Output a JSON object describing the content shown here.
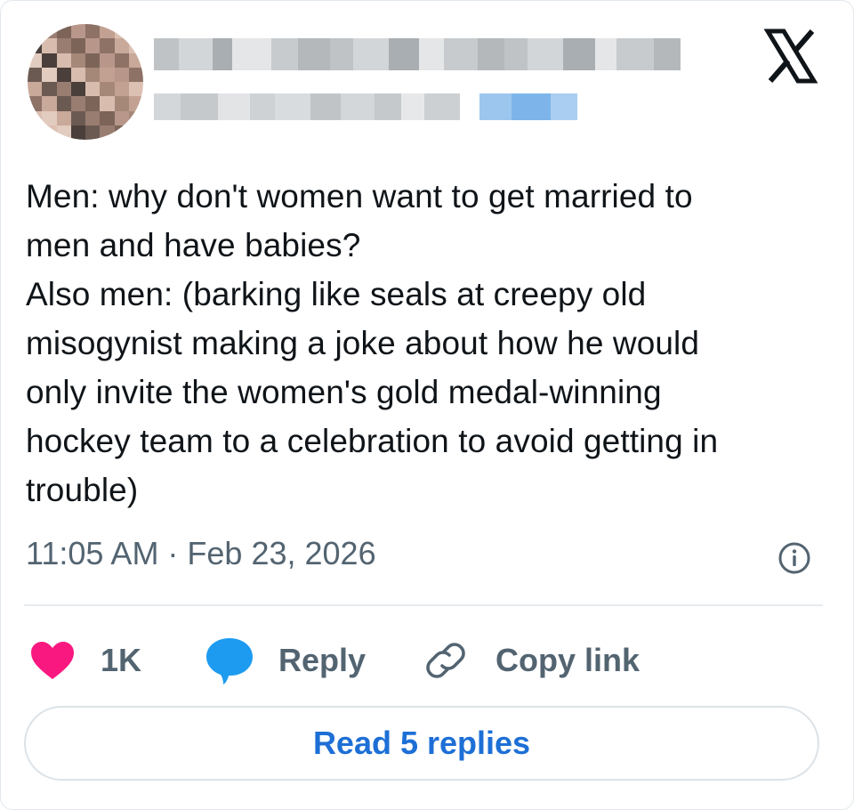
{
  "header": {
    "display_name": "",
    "handle": "",
    "logo": "x-logo-icon"
  },
  "tweet": {
    "lines": [
      "Men: why don't women want to get married to",
      "men and have babies?",
      "Also men: (barking like seals at creepy old",
      "misogynist making a joke about how he would",
      "only invite the women's gold medal-winning",
      "hockey team to a celebration to avoid getting in",
      "trouble)"
    ],
    "timestamp": "11:05 AM · Feb 23, 2026"
  },
  "actions": {
    "like_count": "1K",
    "reply_label": "Reply",
    "copy_link_label": "Copy link"
  },
  "read_replies_label": "Read 5 replies",
  "colors": {
    "heart": "#f91880",
    "reply": "#1d9bf0",
    "link": "#1d6fd6",
    "muted": "#536471"
  },
  "icons": [
    "x-logo-icon",
    "info-icon",
    "heart-icon",
    "reply-bubble-icon",
    "link-icon"
  ]
}
